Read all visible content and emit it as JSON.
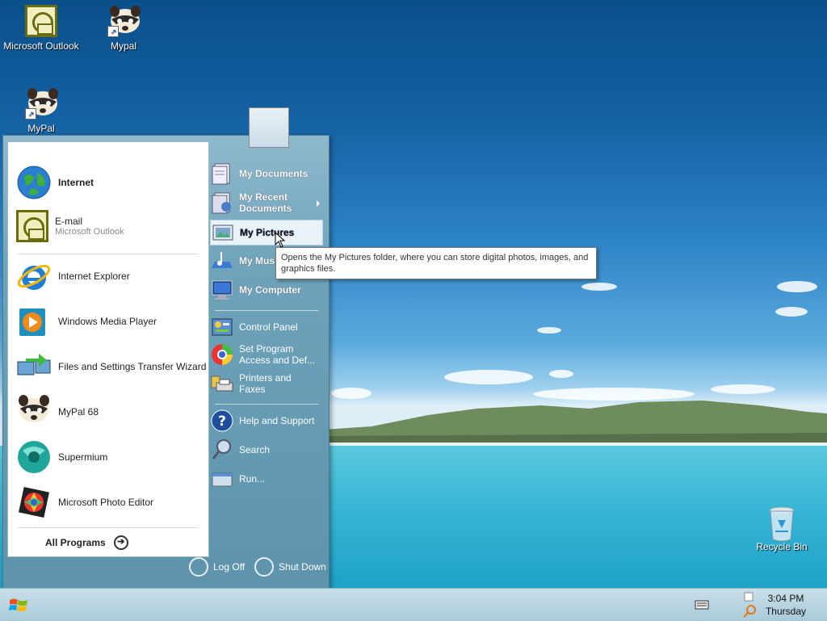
{
  "desktop": {
    "icons": [
      {
        "label": "Microsoft Outlook",
        "icon": "outlook-icon"
      },
      {
        "label": "Mypal",
        "icon": "raccoon-icon"
      },
      {
        "label": "MyPal",
        "icon": "raccoon-icon"
      },
      {
        "label": "Recycle Bin",
        "icon": "recycle-bin-icon"
      }
    ]
  },
  "start_menu": {
    "pinned": [
      {
        "title": "Internet",
        "subtitle": ""
      },
      {
        "title": "E-mail",
        "subtitle": "Microsoft Outlook"
      }
    ],
    "recent": [
      {
        "title": "Internet Explorer"
      },
      {
        "title": "Windows Media Player"
      },
      {
        "title": "Files and Settings Transfer Wizard"
      },
      {
        "title": "MyPal 68"
      },
      {
        "title": "Supermium"
      },
      {
        "title": "Microsoft Photo Editor"
      }
    ],
    "all_programs": "All Programs",
    "right": {
      "my_documents": "My Documents",
      "my_recent_documents": "My Recent Documents",
      "my_pictures": "My Pictures",
      "my_music": "My Music",
      "my_computer": "My Computer",
      "control_panel": "Control Panel",
      "set_program_access": "Set Program Access and Def...",
      "printers_faxes": "Printers and Faxes",
      "help_support": "Help and Support",
      "search": "Search",
      "run": "Run..."
    },
    "log_off": "Log Off",
    "shut_down": "Shut Down"
  },
  "tooltip": {
    "text": "Opens the My Pictures folder, where you can store digital photos, images, and graphics files."
  },
  "taskbar": {
    "time": "3:04 PM",
    "day": "Thursday"
  },
  "colors": {
    "menu_blue": "#6ea3ba",
    "taskbar": "#bcd7e3"
  }
}
